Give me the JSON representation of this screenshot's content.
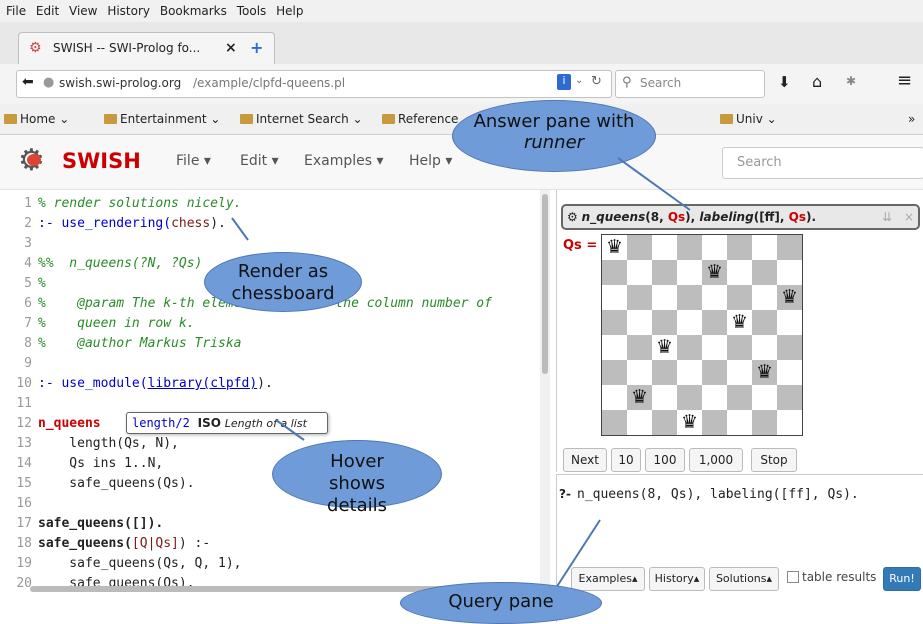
{
  "menubar": {
    "items": [
      "File",
      "Edit",
      "View",
      "History",
      "Bookmarks",
      "Tools",
      "Help"
    ]
  },
  "tab": {
    "title": "SWISH -- SWI-Prolog fo...",
    "close": "×",
    "new_tab": "+"
  },
  "nav": {
    "url_host": "swish.swi-prolog.org",
    "url_path": "/example/clpfd-queens.pl",
    "search_placeholder": "Search"
  },
  "bookmarks": {
    "items": [
      "Home",
      "Entertainment",
      "Internet Search",
      "Reference",
      "Univ"
    ]
  },
  "swish": {
    "logo": "SWISH",
    "menus": [
      "File",
      "Edit",
      "Examples",
      "Help"
    ],
    "search_placeholder": "Search"
  },
  "editor": {
    "lines": [
      {
        "n": "1"
      },
      {
        "n": "2"
      },
      {
        "n": "3"
      },
      {
        "n": "4"
      },
      {
        "n": "5"
      },
      {
        "n": "6"
      },
      {
        "n": "7"
      },
      {
        "n": "8"
      },
      {
        "n": "9"
      },
      {
        "n": "10"
      },
      {
        "n": "11"
      },
      {
        "n": "12"
      },
      {
        "n": "13"
      },
      {
        "n": "14"
      },
      {
        "n": "15"
      },
      {
        "n": "16"
      },
      {
        "n": "17"
      },
      {
        "n": "18"
      },
      {
        "n": "19"
      },
      {
        "n": "20"
      }
    ],
    "l1": "% render solutions nicely.",
    "l2a": ":- use_rendering(",
    "l2b": "chess",
    "l2c": ").",
    "l4": "%%  n_queens(?N, ?Qs)",
    "l5": "%",
    "l6": "%    @param The k-th element of Qs is the column number of",
    "l7": "%    queen in row k.",
    "l8": "%    @author Markus Triska",
    "l10a": ":- use_module(",
    "l10b": "library(clpfd)",
    "l10c": ").",
    "l12a": "n_queens",
    "l13": "    length(Qs, N),",
    "l14": "    Qs ins 1..N,",
    "l15": "    safe_queens(Qs).",
    "l17": "safe_queens([]).",
    "l18a": "safe_queens(",
    "l18b": "[Q|Qs]",
    "l18c": ") :-",
    "l19": "    safe_queens(Qs, Q, 1),",
    "l20": "    safe_queens(Qs)."
  },
  "tooltip": {
    "pred": "length/2",
    "iso": "ISO",
    "desc": "Length of a list"
  },
  "answer": {
    "query_a": "n_queens",
    "query_b": "(8, ",
    "query_c": "Qs",
    "query_d": "), ",
    "query_e": "labeling",
    "query_f": "([ff], ",
    "query_g": "Qs",
    "query_h": ").",
    "var_label": "Qs =",
    "queens": [
      1,
      5,
      8,
      6,
      3,
      7,
      2,
      4
    ],
    "board_size": 8,
    "queen_glyph": "♛",
    "buttons": [
      "Next",
      "10",
      "100",
      "1,000",
      "Stop"
    ]
  },
  "query": {
    "prompt": "?-",
    "text": "n_queens(8, Qs), labeling([ff], Qs).",
    "buttons": [
      "Examples",
      "History",
      "Solutions"
    ],
    "checkbox_label": "table results",
    "run": "Run!"
  },
  "callouts": {
    "answer_pane_a": "Answer pane with",
    "answer_pane_b": "runner",
    "render": "Render as chessboard",
    "hover": "Hover shows details",
    "query_pane": "Query pane"
  },
  "colors": {
    "accent_red": "#c00000",
    "run_button": "#337ab7",
    "callout": "#6f9bd8"
  }
}
